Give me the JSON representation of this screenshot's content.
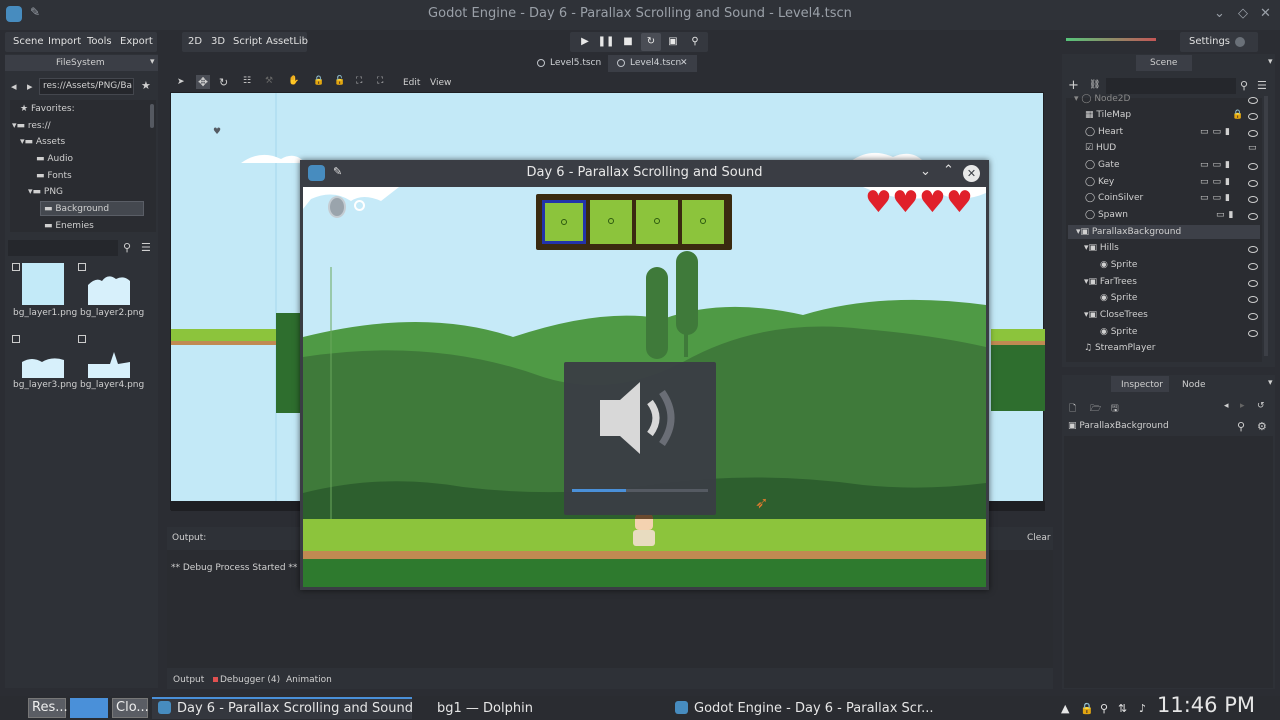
{
  "window": {
    "title": "Godot Engine - Day 6 - Parallax Scrolling and Sound - Level4.tscn"
  },
  "menubar": {
    "items": [
      "Scene",
      "Import",
      "Tools",
      "Export"
    ],
    "workspaces": [
      "2D",
      "3D",
      "Script",
      "AssetLib"
    ],
    "settings": "Settings"
  },
  "scene_tabs": [
    "Level5.tscn",
    "Level4.tscn"
  ],
  "viewport_toolbar": {
    "edit": "Edit",
    "view": "View"
  },
  "filesystem": {
    "tab": "FileSystem",
    "path": "res://Assets/PNG/Ba",
    "tree": [
      "Favorites:",
      "res://",
      "Assets",
      "Audio",
      "Fonts",
      "PNG",
      "Background",
      "Enemies"
    ],
    "files": [
      "bg_layer1.png",
      "bg_layer2.png",
      "bg_layer3.png",
      "bg_layer4.png"
    ]
  },
  "scene_panel": {
    "tab": "Scene",
    "nodes": [
      "Node2D",
      "TileMap",
      "Heart",
      "HUD",
      "Gate",
      "Key",
      "CoinSilver",
      "Spawn",
      "ParallaxBackground",
      "Hills",
      "Sprite",
      "FarTrees",
      "Sprite",
      "CloseTrees",
      "Sprite",
      "StreamPlayer"
    ]
  },
  "inspector": {
    "tabs": [
      "Inspector",
      "Node"
    ],
    "selected": "ParallaxBackground"
  },
  "output": {
    "label": "Output:",
    "clear": "Clear",
    "text": "** Debug Process Started **",
    "bottom_tabs": [
      "Output",
      "Debugger (4)",
      "Animation"
    ]
  },
  "game_window": {
    "title": "Day 6 - Parallax Scrolling and Sound",
    "hearts": 4,
    "volume_level": 0.4
  },
  "taskbar": {
    "items": [
      "Res...",
      "Clo...",
      "Day 6 - Parallax Scrolling and Sound",
      "bg1 — Dolphin",
      "Godot Engine - Day 6 - Parallax Scr..."
    ],
    "clock": "11:46 PM"
  },
  "colors": {
    "accent": "#4a90d9",
    "grass": "#8cc43c",
    "hill_dark": "#3f7a3a",
    "sky": "#c6eaf8"
  }
}
